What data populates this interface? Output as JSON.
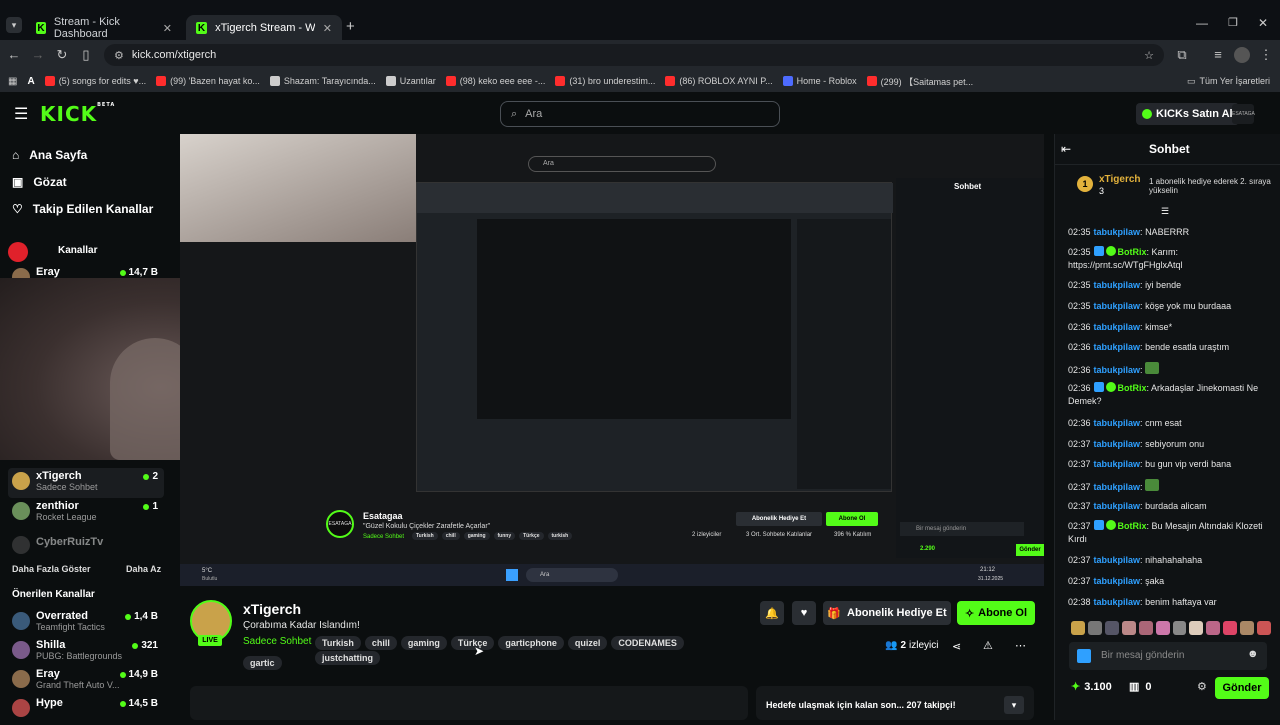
{
  "browser": {
    "tabs": [
      {
        "label": "Stream - Kick Dashboard"
      },
      {
        "label": "xTigerch Stream - Watch Live o"
      }
    ],
    "url": "kick.com/xtigerch",
    "bookmarks": [
      {
        "label": "(5) songs for edits ♥...",
        "color": "#ff2d2d"
      },
      {
        "label": "(99) 'Bazen hayat ko...",
        "color": "#ff2d2d"
      },
      {
        "label": "Shazam: Tarayıcında...",
        "color": "#cccccc"
      },
      {
        "label": "Uzantılar",
        "color": "#cccccc"
      },
      {
        "label": "(98) keko eee eee -...",
        "color": "#ff2d2d"
      },
      {
        "label": "(31) bro underestim...",
        "color": "#ff2d2d"
      },
      {
        "label": "(86) ROBLOX AYNI P...",
        "color": "#ff2d2d"
      },
      {
        "label": "Home - Roblox",
        "color": "#4d6bff"
      },
      {
        "label": "(299) 【Saitamas pet...",
        "color": "#ff2d2d"
      }
    ],
    "all_bookmarks": "Tüm Yer İşaretleri"
  },
  "header": {
    "logo": "KICK",
    "logo_sup": "BETA",
    "search_placeholder": "Ara",
    "buy_kicks": "KICKs Satın Al"
  },
  "sidebar": {
    "nav": [
      {
        "label": "Ana Sayfa",
        "icon": "home-icon"
      },
      {
        "label": "Gözat",
        "icon": "browse-icon"
      },
      {
        "label": "Takip Edilen Kanallar",
        "icon": "heart-icon"
      }
    ],
    "followed_header": "Kanallar",
    "channels": [
      {
        "name": "Eray",
        "category": "",
        "count": "14,7 B",
        "color": "#8a6b4b"
      },
      {
        "name": "xTigerch",
        "category": "Sadece Sohbet",
        "count": "2",
        "color": "#c9a24a"
      },
      {
        "name": "zenthior",
        "category": "Rocket League",
        "count": "1",
        "color": "#6a8f5a"
      },
      {
        "name": "CyberRuizTv",
        "category": "",
        "count": "",
        "color": "#555555"
      }
    ],
    "show_more": "Daha Fazla Göster",
    "show_less": "Daha Az",
    "recommended_header": "Önerilen Kanallar",
    "recommended": [
      {
        "name": "Overrated",
        "category": "Teamfight Tactics",
        "count": "1,4 B",
        "color": "#3a5a7a"
      },
      {
        "name": "Shilla",
        "category": "PUBG: Battlegrounds",
        "count": "321",
        "color": "#7a5a8a"
      },
      {
        "name": "Eray",
        "category": "Grand Theft Auto V...",
        "count": "14,9 B",
        "color": "#8a6b4b"
      },
      {
        "name": "Hype",
        "category": "",
        "count": "14,5 B",
        "color": "#aa4444"
      }
    ]
  },
  "video": {
    "inner_streamer": "Esatagaa",
    "inner_title": "\"Güzel Kokulu Çiçekler Zarafetle Açarlar\"",
    "inner_category": "Sadece Sohbet",
    "inner_tags": [
      "Turkish",
      "chill",
      "gaming",
      "funny",
      "Türkçe",
      "turkish"
    ],
    "inner_subscribe": "Abonelik Hediye Et",
    "inner_follow": "Abone Ol",
    "inner_viewers": "2 izleyiciler",
    "inner_avg": "3 Ort. Sohbete Katılanlar",
    "inner_percent": "396 % Katılım",
    "inner_chat_title": "Sohbet",
    "inner_chat_placeholder": "Bir mesaj gönderin",
    "inner_send": "Gönder",
    "inner_kicks": "2.290",
    "taskbar_search": "Ara",
    "weather": "5°C",
    "weather_desc": "Bulutlu",
    "clock_time": "21:12",
    "clock_date": "31.12.2025"
  },
  "stream": {
    "name": "xTigerch",
    "title": "Çorabıma Kadar Islandım!",
    "category": "Sadece Sohbet",
    "tags": [
      "Turkish",
      "chill",
      "gaming",
      "Türkçe",
      "garticphone",
      "quizel",
      "CODENAMES",
      "justchatting",
      "gartic"
    ],
    "live_label": "LIVE",
    "gift_button": "Abonelik Hediye Et",
    "follow_button": "Abone Ol",
    "viewers_count": "2",
    "viewers_label": "izleyici",
    "goal_text": "Hedefe ulaşmak için kalan son... 207 takipçi!"
  },
  "chat": {
    "title": "Sohbet",
    "pinned_user": "xTigerch",
    "pinned_count": "3",
    "pinned_rank": "1",
    "pinned_text": "1 abonelik hediye ederek 2. sıraya yükselin",
    "messages": [
      {
        "time": "02:35",
        "user": "tabukpilaw",
        "text": "NABERRR",
        "bot": false
      },
      {
        "time": "02:35",
        "user": "BotRix",
        "text": "Karım: https://prnt.sc/WTgFHglxAtql",
        "bot": true
      },
      {
        "time": "02:35",
        "user": "tabukpilaw",
        "text": "iyi bende",
        "bot": false
      },
      {
        "time": "02:35",
        "user": "tabukpilaw",
        "text": "köşe yok mu burdaaa",
        "bot": false
      },
      {
        "time": "02:36",
        "user": "tabukpilaw",
        "text": "kimse*",
        "bot": false
      },
      {
        "time": "02:36",
        "user": "tabukpilaw",
        "text": "bende esatla uraştım",
        "bot": false
      },
      {
        "time": "02:36",
        "user": "tabukpilaw",
        "text": "",
        "bot": false
      },
      {
        "time": "02:36",
        "user": "BotRix",
        "text": "Arkadaşlar Jinekomasti Ne Demek?",
        "bot": true
      },
      {
        "time": "02:36",
        "user": "tabukpilaw",
        "text": "cnm esat",
        "bot": false
      },
      {
        "time": "02:37",
        "user": "tabukpilaw",
        "text": "sebiyorum onu",
        "bot": false
      },
      {
        "time": "02:37",
        "user": "tabukpilaw",
        "text": "bu gun vip verdi bana",
        "bot": false
      },
      {
        "time": "02:37",
        "user": "tabukpilaw",
        "text": "",
        "bot": false
      },
      {
        "time": "02:37",
        "user": "tabukpilaw",
        "text": "burdada alicam",
        "bot": false
      },
      {
        "time": "02:37",
        "user": "BotRix",
        "text": "Bu Mesajın Altındaki Klozeti Kırdı",
        "bot": true
      },
      {
        "time": "02:37",
        "user": "tabukpilaw",
        "text": "nihahahahaha",
        "bot": false
      },
      {
        "time": "02:37",
        "user": "tabukpilaw",
        "text": "şaka",
        "bot": false
      },
      {
        "time": "02:38",
        "user": "tabukpilaw",
        "text": "benim haftaya var",
        "bot": false
      }
    ],
    "input_placeholder": "Bir mesaj gönderin",
    "kicks": "3.100",
    "gifts": "0",
    "send": "Gönder"
  },
  "colors": {
    "brand": "#53fc18",
    "bg": "#0b0e0f",
    "user": "#2fa0ff"
  }
}
